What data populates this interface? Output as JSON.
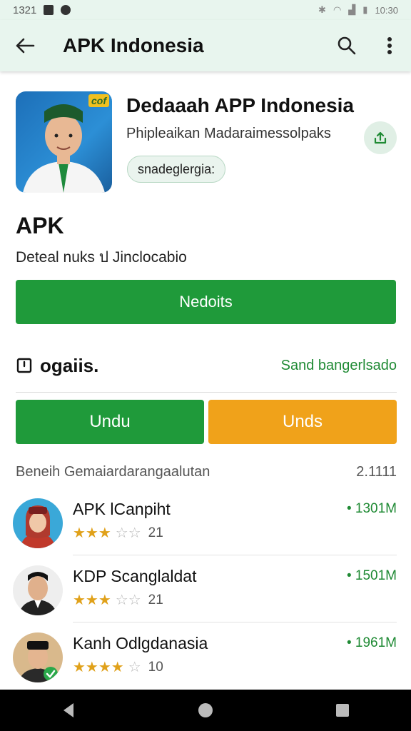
{
  "status_bar": {
    "time_left": "1321",
    "time_right": "10:30",
    "icons_right": [
      "bluetooth-icon",
      "wifi-icon",
      "signal-icon",
      "battery-icon"
    ]
  },
  "app_bar": {
    "title": "APK Indonesia"
  },
  "header": {
    "name": "Dedaaah APP Indonesia",
    "developer": "Phipleaikan Madaraimessolpaks",
    "badge": "cof",
    "tag": "snadeglergia:"
  },
  "section": {
    "title": "APK",
    "description": "Deteal nuks ป Jinclocabio"
  },
  "primary_button": {
    "label": "Nedoits"
  },
  "row_heading": {
    "label": "ogaiis.",
    "link": "Sand bangerlsado"
  },
  "buttons": {
    "green": "Undu",
    "orange": "Unds"
  },
  "list": {
    "heading": "Beneih Gemaiardarangaalutan",
    "count": "2.1111",
    "items": [
      {
        "title": "APK lCanpiht",
        "rating_count": "21",
        "rating": 3.5,
        "size": "• 1301M"
      },
      {
        "title": "KDP Scanglaldat",
        "rating_count": "21",
        "rating": 3.5,
        "size": "• 1501M"
      },
      {
        "title": "Kanh Odlgdanasia",
        "rating_count": "10",
        "rating": 4,
        "size": "• 1961M"
      }
    ]
  },
  "colors": {
    "accent_green": "#1f9a3a",
    "accent_orange": "#f0a21a",
    "appbar_bg": "#e8f5ee"
  }
}
